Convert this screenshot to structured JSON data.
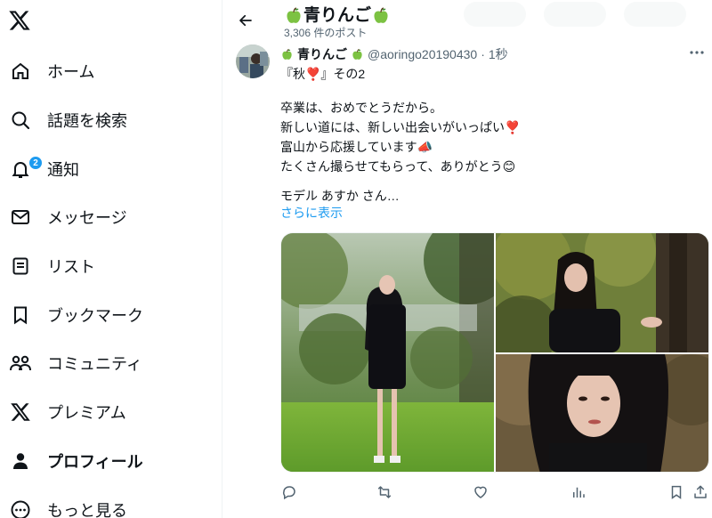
{
  "sidebar": {
    "logo": "x-logo-icon",
    "items": [
      {
        "label": "ホーム",
        "icon": "home-icon"
      },
      {
        "label": "話題を検索",
        "icon": "search-icon"
      },
      {
        "label": "通知",
        "icon": "bell-icon",
        "badge": "2"
      },
      {
        "label": "メッセージ",
        "icon": "mail-icon"
      },
      {
        "label": "リスト",
        "icon": "list-icon"
      },
      {
        "label": "ブックマーク",
        "icon": "bookmark-icon"
      },
      {
        "label": "コミュニティ",
        "icon": "community-icon"
      },
      {
        "label": "プレミアム",
        "icon": "x-premium-icon"
      },
      {
        "label": "プロフィール",
        "icon": "profile-icon",
        "active": true
      },
      {
        "label": "もっと見る",
        "icon": "more-circle-icon"
      }
    ]
  },
  "header": {
    "name": "青りんご",
    "post_count": "3,306 件のポスト"
  },
  "tweet": {
    "author_name": "青りんご",
    "handle": "@aoringo20190430",
    "separator": "·",
    "time": "1秒",
    "lines": [
      "『秋❣️』その2",
      "",
      "卒業は、おめでとうだから。",
      "新しい道には、新しい出会いがいっぱい❣️",
      "富山から応援しています📣",
      "たくさん撮らせてもらって、ありがとう😊",
      "",
      "モデル あすか さん…"
    ],
    "show_more": "さらに表示"
  },
  "actions": [
    "reply-icon",
    "retweet-icon",
    "like-icon",
    "views-icon",
    "bookmark-icon",
    "share-icon"
  ],
  "colors": {
    "accent": "#1d9bf0",
    "text": "#0f1419",
    "muted": "#536471",
    "apple_green": "#7cc242"
  }
}
